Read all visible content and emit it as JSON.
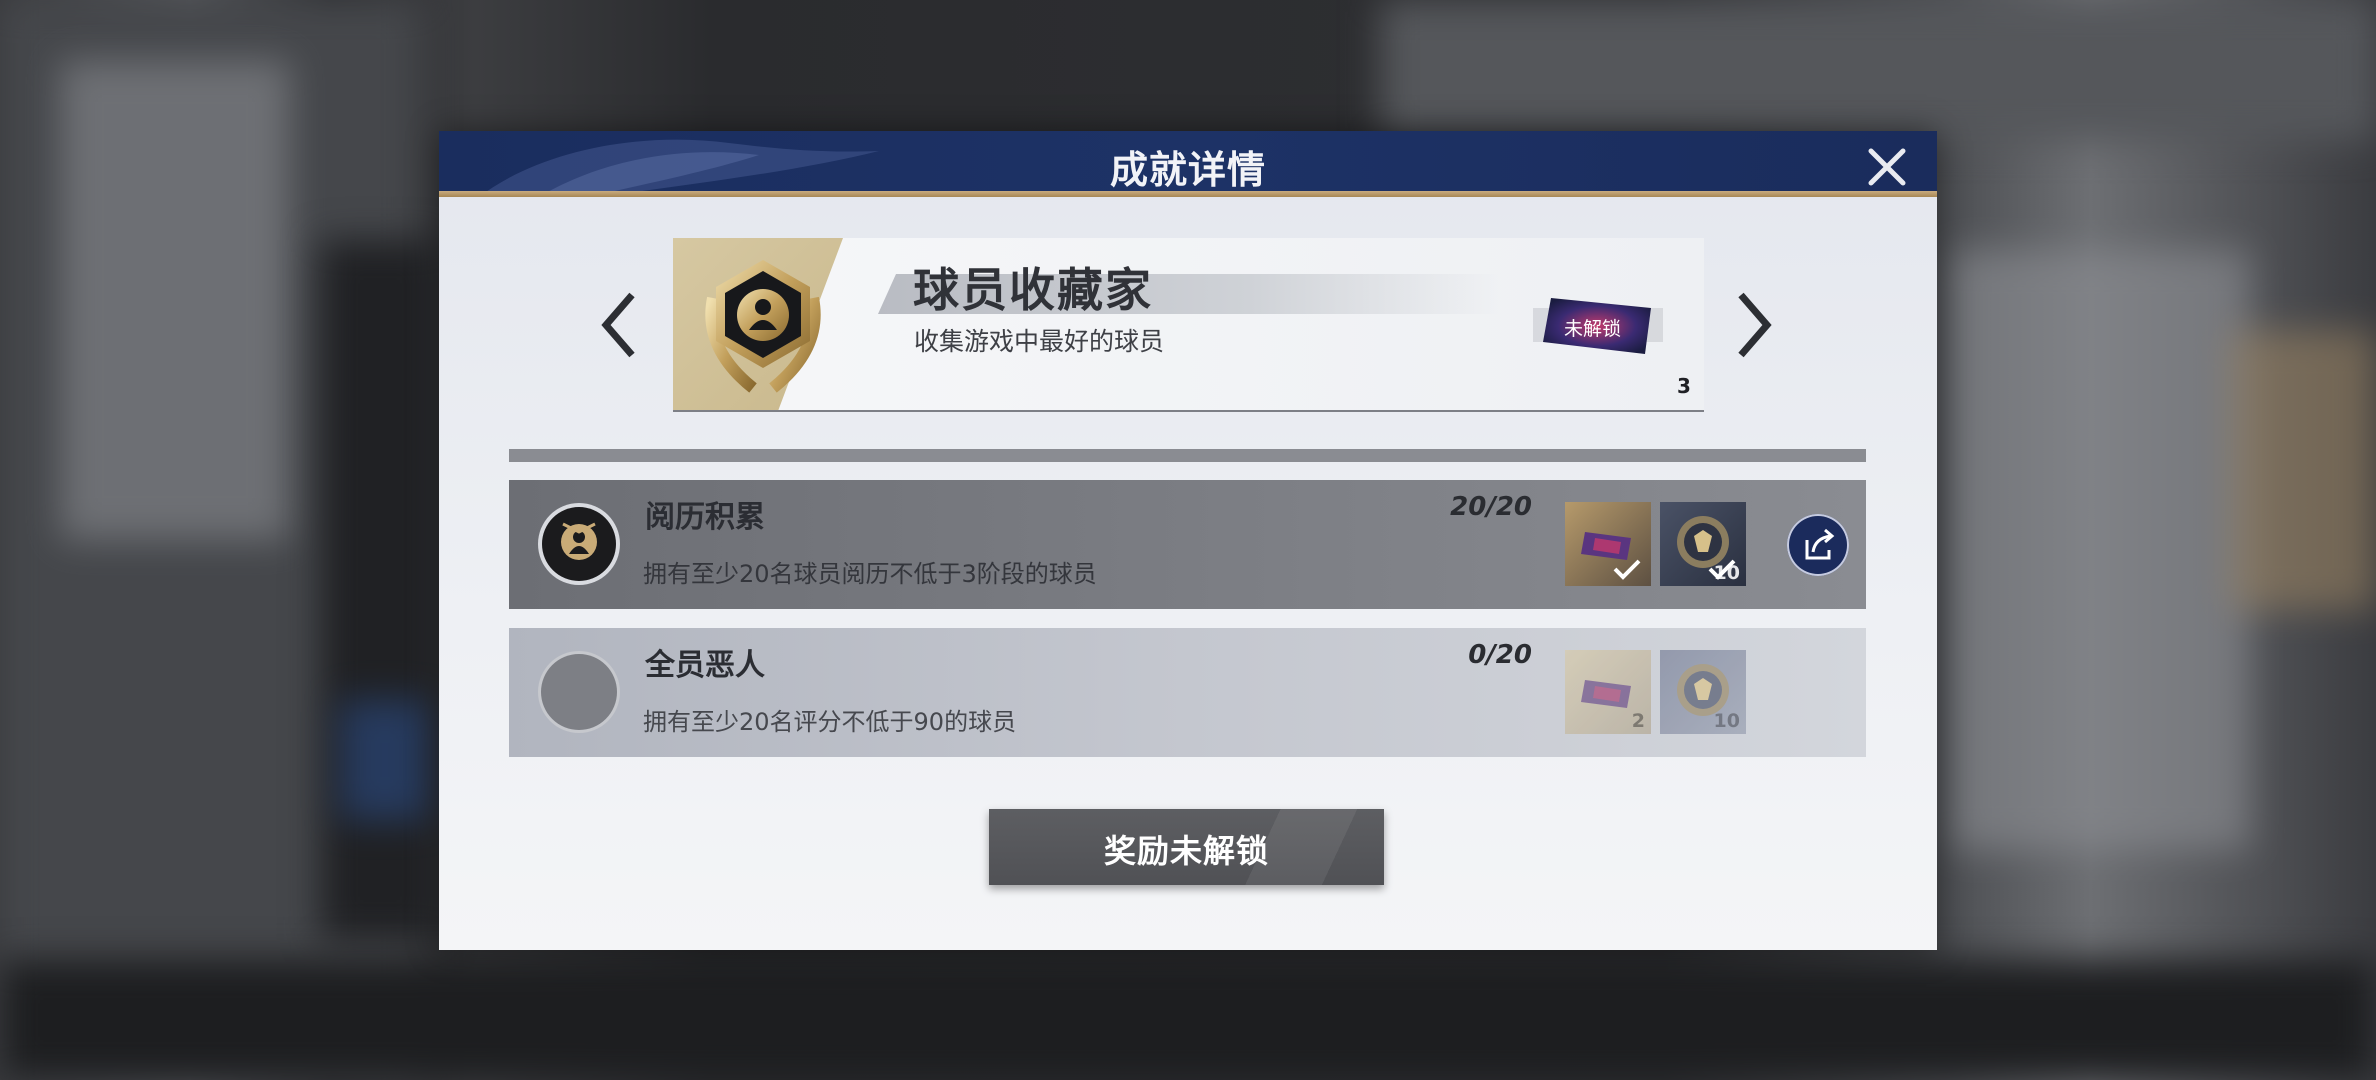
{
  "dialog": {
    "title": "成就详情",
    "close_icon": "close-icon"
  },
  "achievement": {
    "title": "球员收藏家",
    "description": "收集游戏中最好的球员",
    "badge_icon": "player-medal-icon",
    "reward": {
      "icon": "player-pack-icon",
      "status": "未解锁",
      "count": "3"
    },
    "prev_icon": "chevron-left-icon",
    "next_icon": "chevron-right-icon"
  },
  "tasks": [
    {
      "name": "阅历积累",
      "description": "拥有至少20名球员阅历不低于3阶段的球员",
      "progress": "20/20",
      "completed": true,
      "rewards": [
        {
          "icon": "player-pack-icon",
          "claimed": true
        },
        {
          "icon": "coin-medal-icon",
          "quantity": "10",
          "claimed": true
        }
      ],
      "share_icon": "share-icon"
    },
    {
      "name": "全员恶人",
      "description": "拥有至少20名评分不低于90的球员",
      "progress": "0/20",
      "completed": false,
      "rewards": [
        {
          "icon": "player-pack-icon",
          "quantity": "2"
        },
        {
          "icon": "coin-medal-icon",
          "quantity": "10"
        }
      ]
    }
  ],
  "claim_button": {
    "label": "奖励未解锁"
  },
  "colors": {
    "header": "#1d3266",
    "accent_gold": "#c9ab7e",
    "button": "#565759"
  }
}
